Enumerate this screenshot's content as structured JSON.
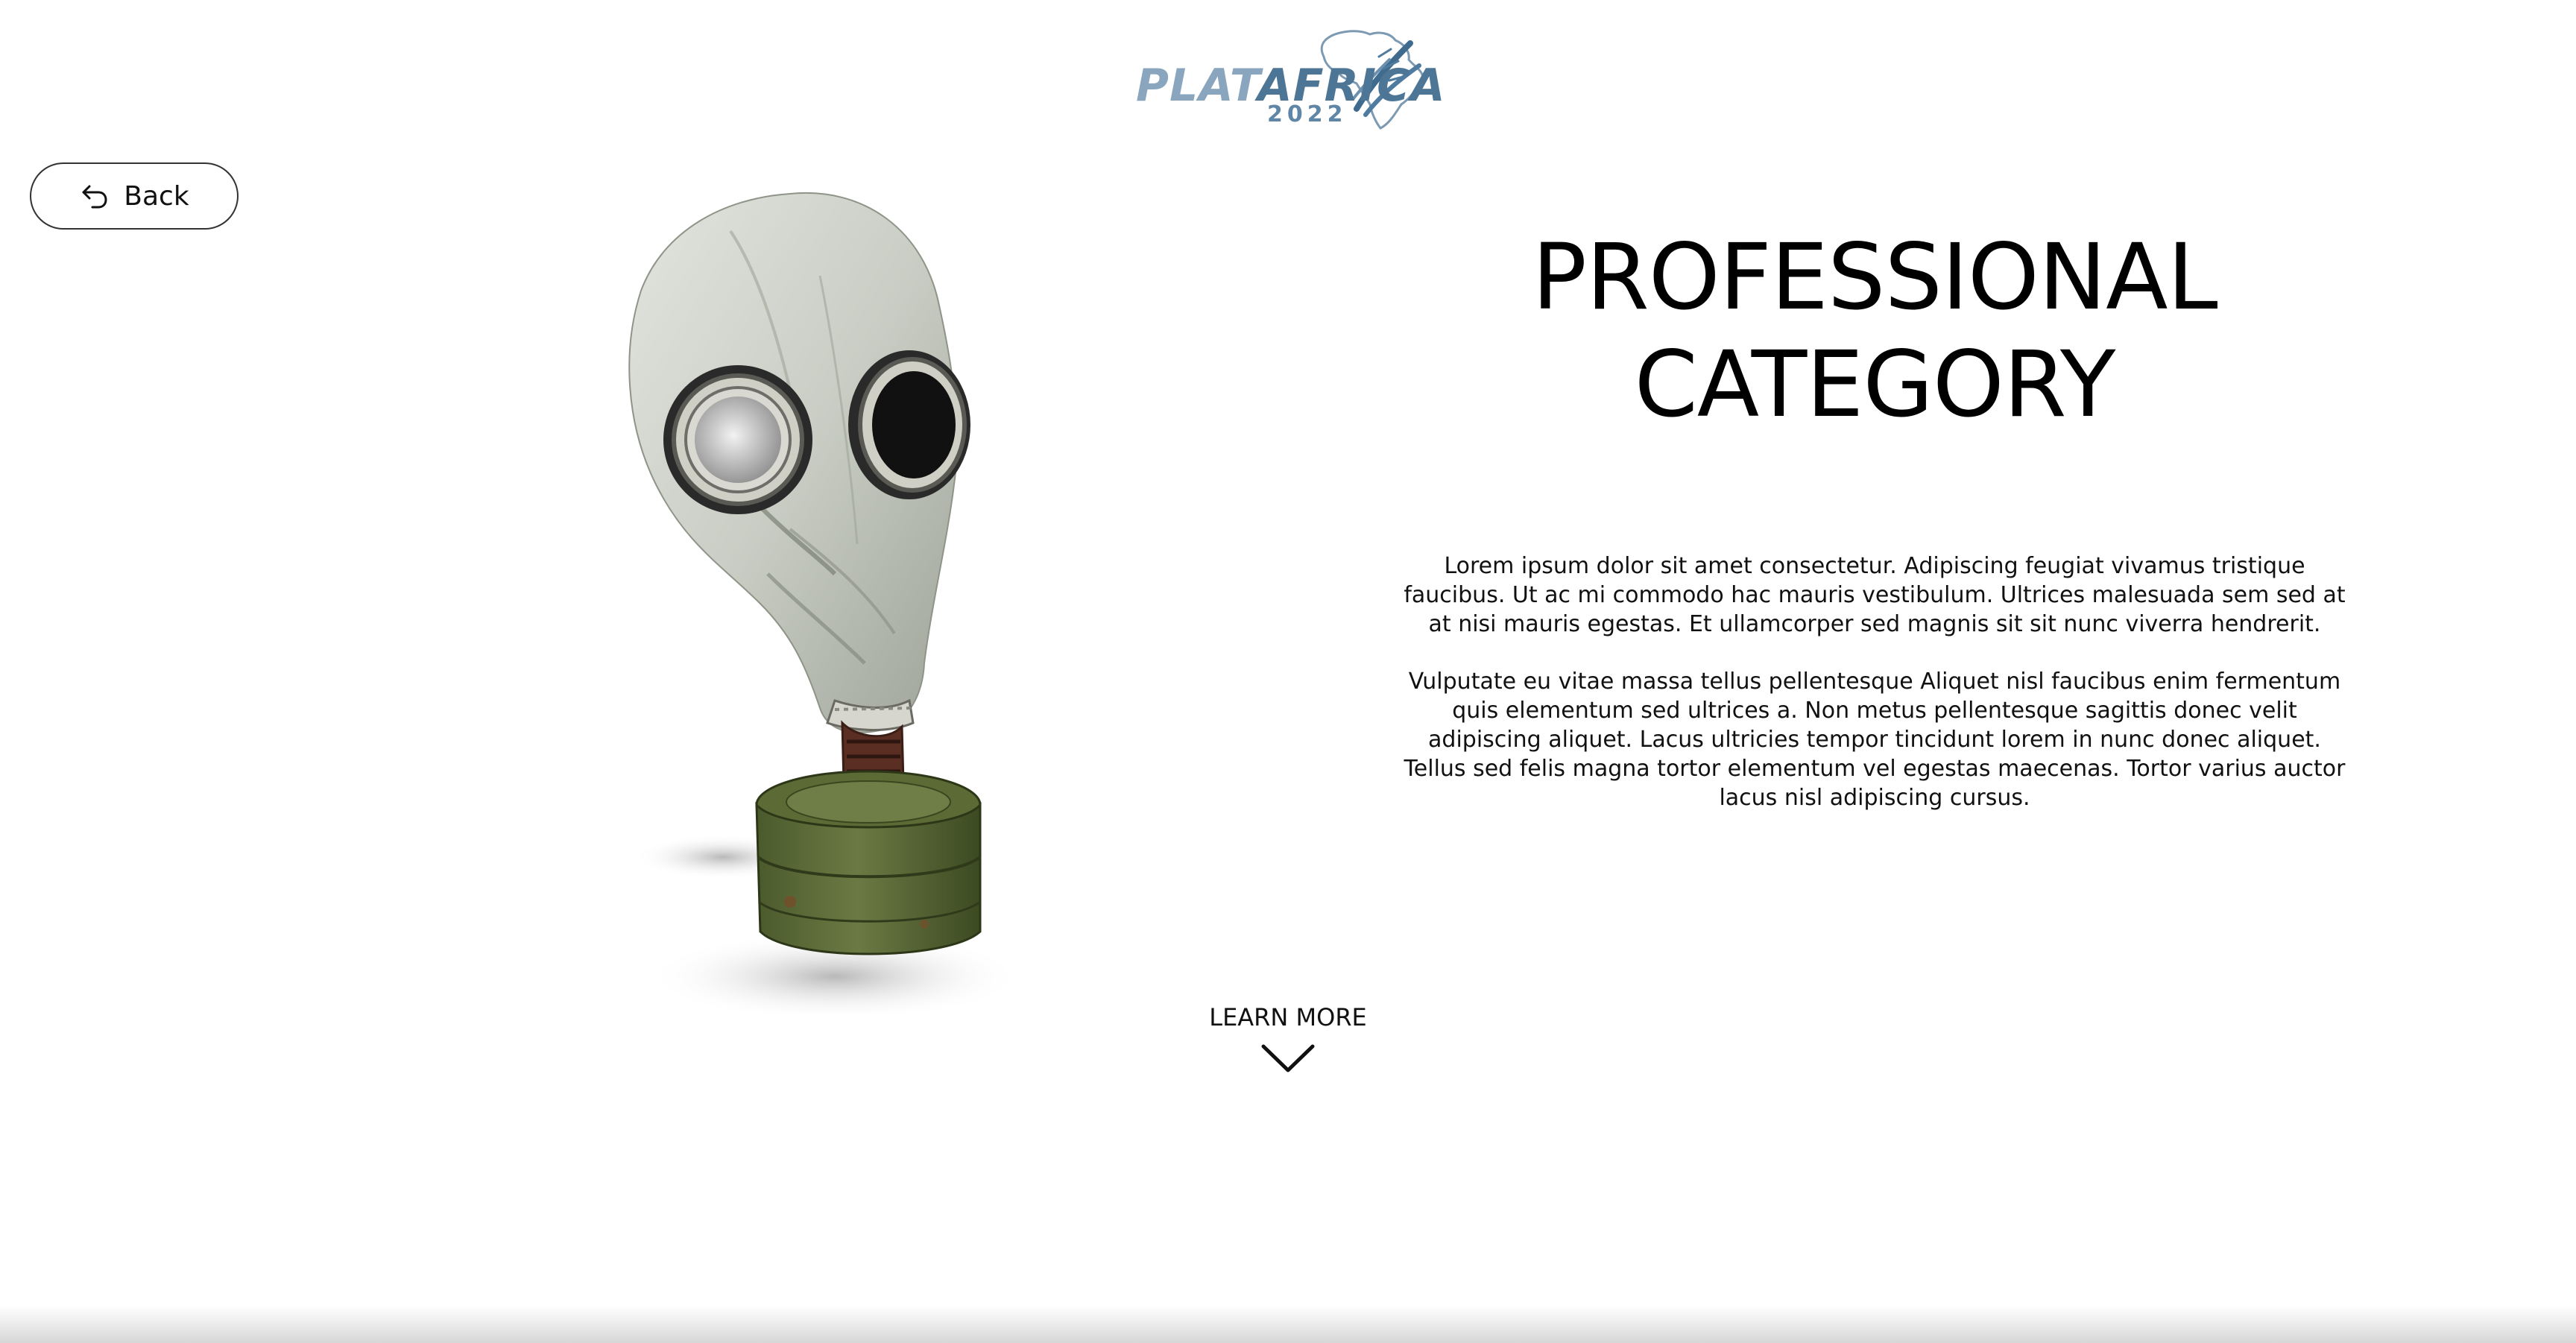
{
  "logo": {
    "wordmark_plain": "PLAT",
    "wordmark_accent": "AFRICA",
    "year": "2022",
    "colors": {
      "light": "#8aa6bf",
      "dark": "#4d7596"
    }
  },
  "nav": {
    "back_label": "Back",
    "back_icon": "undo-arrow-icon"
  },
  "hero": {
    "title_line1": "PROFESSIONAL",
    "title_line2": "CATEGORY",
    "image_subject": "gas-mask-illustration",
    "paragraphs": [
      "Lorem ipsum dolor sit amet consectetur. Adipiscing feugiat vivamus tristique faucibus. Ut ac mi commodo hac mauris vestibulum. Ultrices malesuada sem sed at at nisi mauris egestas. Et ullamcorper sed magnis sit sit nunc viverra hendrerit.",
      "Vulputate eu vitae massa tellus pellentesque Aliquet nisl faucibus enim fermentum quis elementum sed ultrices a. Non metus pellentesque sagittis donec velit adipiscing aliquet. Lacus ultricies tempor tincidunt lorem in nunc donec aliquet. Tellus sed felis magna tortor elementum vel egestas maecenas. Tortor varius auctor lacus nisl adipiscing cursus."
    ]
  },
  "learn_more": {
    "label": "LEARN MORE",
    "icon": "chevron-down-icon"
  }
}
